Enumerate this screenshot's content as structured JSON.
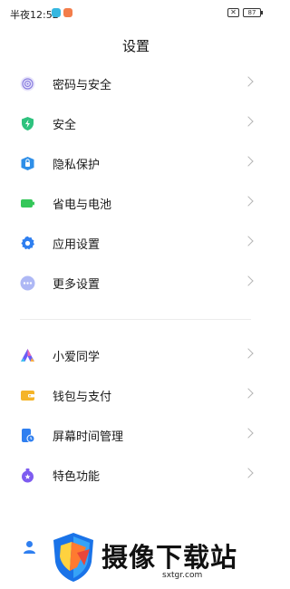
{
  "status": {
    "time": "半夜12:52",
    "close_badge": "✕",
    "battery": "87"
  },
  "header": {
    "title": "设置"
  },
  "group1": [
    {
      "label": "密码与安全",
      "icon": "fingerprint-icon",
      "color": "#8a7fe0"
    },
    {
      "label": "安全",
      "icon": "shield-bolt-icon",
      "color": "#2ec27e"
    },
    {
      "label": "隐私保护",
      "icon": "privacy-icon",
      "color": "#2f8fe8"
    },
    {
      "label": "省电与电池",
      "icon": "battery-icon",
      "color": "#34c759"
    },
    {
      "label": "应用设置",
      "icon": "gear-icon",
      "color": "#2f7ff0"
    },
    {
      "label": "更多设置",
      "icon": "more-dots-icon",
      "color": "#7f8ff0"
    }
  ],
  "group2": [
    {
      "label": "小爱同学",
      "icon": "xiaoai-icon",
      "color": "#6a5cf6"
    },
    {
      "label": "钱包与支付",
      "icon": "wallet-icon",
      "color": "#f5b428"
    },
    {
      "label": "屏幕时间管理",
      "icon": "screen-time-icon",
      "color": "#2f7ff0"
    },
    {
      "label": "特色功能",
      "icon": "features-icon",
      "color": "#7e5cf0"
    }
  ],
  "watermark": {
    "text": "摄像下载站",
    "url": "sxtgr.com"
  }
}
